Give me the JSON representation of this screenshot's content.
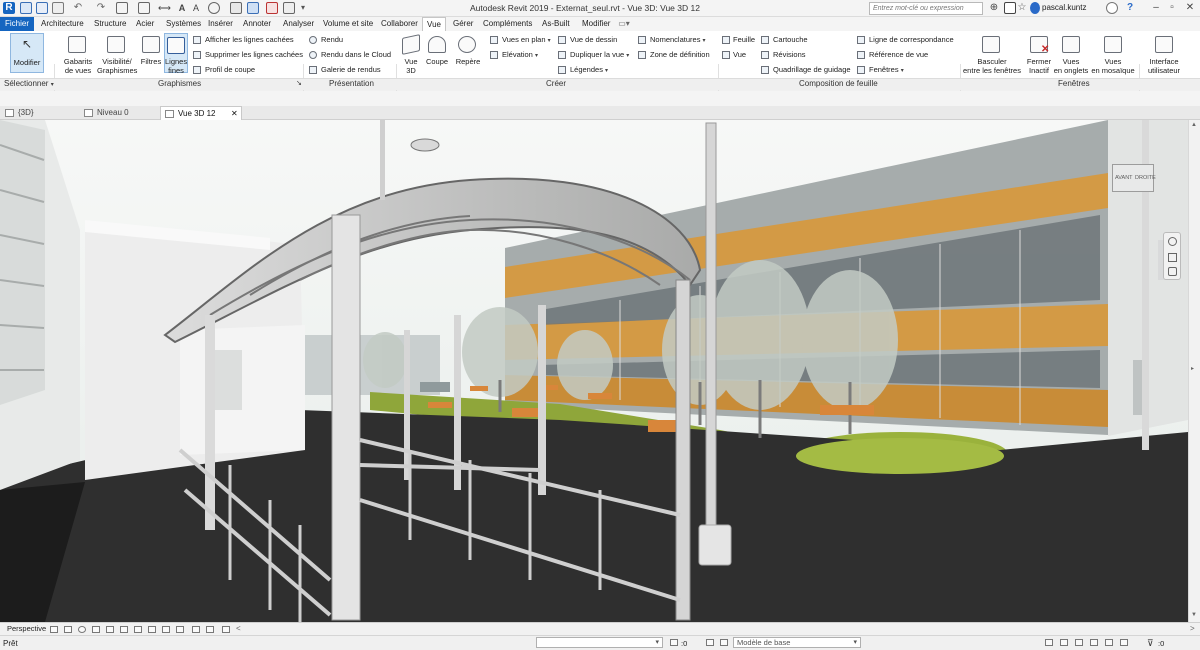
{
  "app": {
    "title": "Autodesk Revit 2019 - Externat_seul.rvt - Vue 3D: Vue 3D 12",
    "search_placeholder": "Entrez mot-clé ou expression",
    "user": "pascal.kuntz"
  },
  "tabs": [
    {
      "label": "Fichier"
    },
    {
      "label": "Architecture"
    },
    {
      "label": "Structure"
    },
    {
      "label": "Acier"
    },
    {
      "label": "Systèmes"
    },
    {
      "label": "Insérer"
    },
    {
      "label": "Annoter"
    },
    {
      "label": "Analyser"
    },
    {
      "label": "Volume et site"
    },
    {
      "label": "Collaborer"
    },
    {
      "label": "Vue"
    },
    {
      "label": "Gérer"
    },
    {
      "label": "Compléments"
    },
    {
      "label": "As-Built"
    },
    {
      "label": "Modifier"
    }
  ],
  "active_tab": "Vue",
  "ribbon": {
    "modifier": "Modifier",
    "selectionner": "Sélectionner",
    "gabarits": [
      "Gabarits",
      "de vues"
    ],
    "visibilite": [
      "Visibilité/",
      "Graphismes"
    ],
    "filtres": "Filtres",
    "lignes_fines": [
      "Lignes",
      "fines"
    ],
    "afficher_lignes": "Afficher les lignes cachées",
    "supprimer_lignes": "Supprimer les lignes cachées",
    "profil_coupe": "Profil de coupe",
    "graphismes_panel": "Graphismes",
    "rendu": "Rendu",
    "rendu_cloud": "Rendu  dans le Cloud",
    "galerie": "Galerie de rendus",
    "presentation_panel": "Présentation",
    "vue3d": [
      "Vue",
      "3D"
    ],
    "coupe": "Coupe",
    "repere": "Repère",
    "vues_en_plan": "Vues en plan",
    "elevation": "Elévation",
    "vue_de_dessin": "Vue de dessin",
    "dupliquer": "Dupliquer la vue",
    "legendes": "Légendes",
    "nomenclatures": "Nomenclatures",
    "zone_definition": "Zone de définition",
    "creer_panel": "Créer",
    "feuille": "Feuille",
    "vue": "Vue",
    "cartouche": "Cartouche",
    "revisions": "Révisions",
    "quadrillage": "Quadrillage de guidage",
    "ligne_correspondance": "Ligne de correspondance",
    "reference_vue": "Référence de vue",
    "fenetres": "Fenêtres",
    "composition_panel": "Composition de feuille",
    "basculer": [
      "Basculer",
      "entre les fenêtres"
    ],
    "fermer_inactif": [
      "Fermer",
      "Inactif"
    ],
    "vues_onglets": [
      "Vues",
      "en onglets"
    ],
    "vues_mosaique": [
      "Vues",
      "en mosaïque"
    ],
    "interface": [
      "Interface",
      "utilisateur"
    ],
    "fenetres_panel": "Fenêtres"
  },
  "view_tabs": [
    {
      "label": "{3D}"
    },
    {
      "label": "Niveau 0"
    },
    {
      "label": "Vue 3D 12",
      "close": "✕"
    }
  ],
  "viewcube": {
    "front": "AVANT",
    "right": "DROITE"
  },
  "view_bar": {
    "mode": "Perspective"
  },
  "status_bar": {
    "status": "Prêt",
    "count": ":0",
    "model": "Modèle de base",
    "filter_count": ":0"
  },
  "colors": {
    "file_tab": "#1565c0",
    "facade_band": "#d39a45",
    "ground": "#2f2f2f",
    "lawn": "#9ab23c",
    "sky": "#f2f5f2"
  }
}
